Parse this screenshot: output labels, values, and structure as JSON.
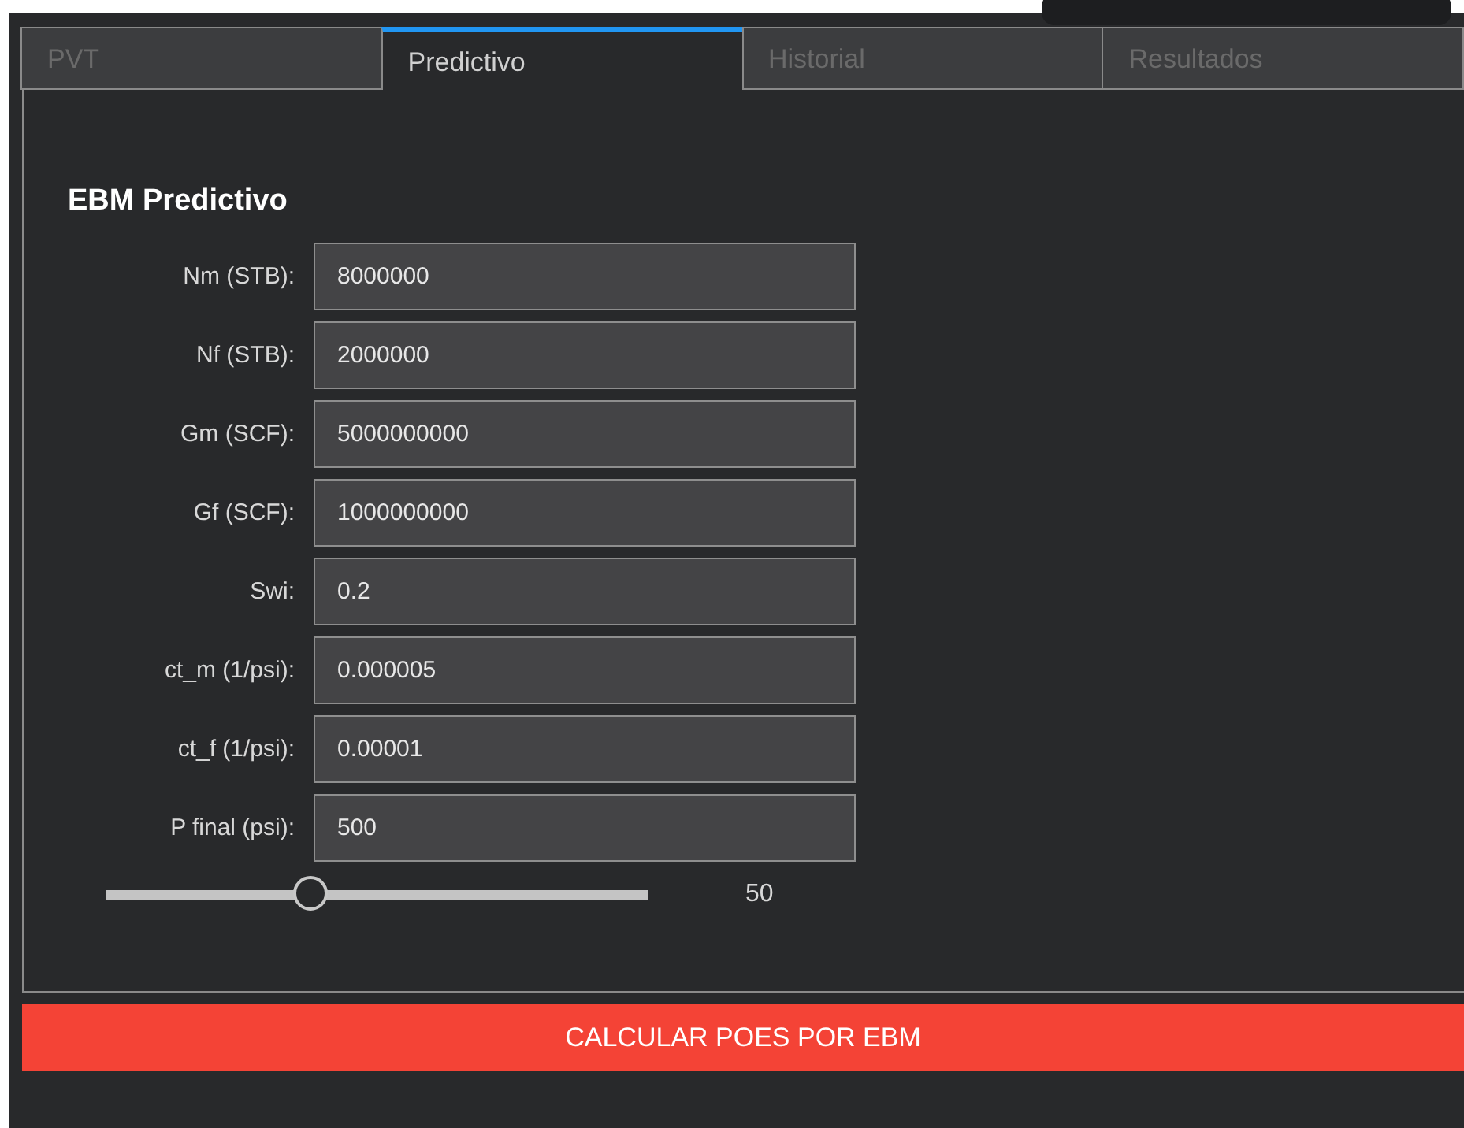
{
  "tabs": [
    {
      "label": "PVT",
      "selected": false
    },
    {
      "label": "Predictivo",
      "selected": true
    },
    {
      "label": "Historial",
      "selected": false
    },
    {
      "label": "Resultados",
      "selected": false
    }
  ],
  "section_title": "EBM Predictivo",
  "fields": [
    {
      "label": "Nm (STB):",
      "value": "8000000"
    },
    {
      "label": "Nf (STB):",
      "value": "2000000"
    },
    {
      "label": "Gm (SCF):",
      "value": "5000000000"
    },
    {
      "label": "Gf (SCF):",
      "value": "1000000000"
    },
    {
      "label": "Swi:",
      "value": "0.2"
    },
    {
      "label": "ct_m (1/psi):",
      "value": "0.000005"
    },
    {
      "label": "ct_f (1/psi):",
      "value": "0.00001"
    },
    {
      "label": "P final (psi):",
      "value": "500"
    }
  ],
  "slider": {
    "level": 0.38,
    "reading": "50"
  },
  "action_button": "CALCULAR POES POR EBM"
}
